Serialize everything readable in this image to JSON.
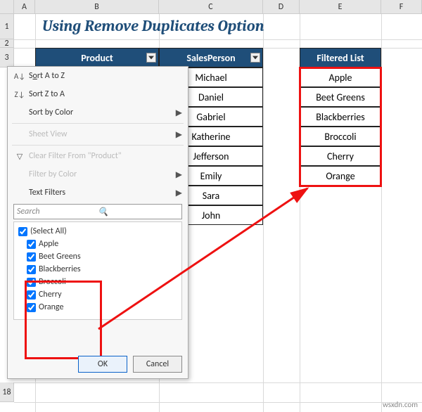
{
  "title": "Using Remove Duplicates Option",
  "columns": {
    "A": "A",
    "B": "B",
    "C": "C",
    "D": "D",
    "E": "E",
    "F": "F"
  },
  "rows": [
    "1",
    "2",
    "3",
    "18"
  ],
  "headers": {
    "product": "Product",
    "salesperson": "SalesPerson",
    "filtered": "Filtered List"
  },
  "salespeople": [
    "Michael",
    "Daniel",
    "Gabriel",
    "Katherine",
    "Jefferson",
    "Emily",
    "Sara",
    "John"
  ],
  "filtered_list": [
    "Apple",
    "Beet Greens",
    "Blackberries",
    "Broccoli",
    "Cherry",
    "Orange"
  ],
  "popup": {
    "sort_az_prefix": "S",
    "sort_az_underline": "o",
    "sort_az_rest": "rt A to Z",
    "sort_za": "Sort Z to A",
    "sort_color": "Sort by Color",
    "sheet_view": "Sheet View",
    "clear_filter": "Clear Filter From \"Product\"",
    "filter_color": "Filter by Color",
    "text_filters": "Text Filters",
    "search_placeholder": "Search",
    "select_all": "(Select All)",
    "items": [
      "Apple",
      "Beet Greens",
      "Blackberries",
      "Broccoli",
      "Cherry",
      "Orange"
    ],
    "ok": "OK",
    "cancel": "Cancel"
  },
  "watermark": "wsxdn.com"
}
